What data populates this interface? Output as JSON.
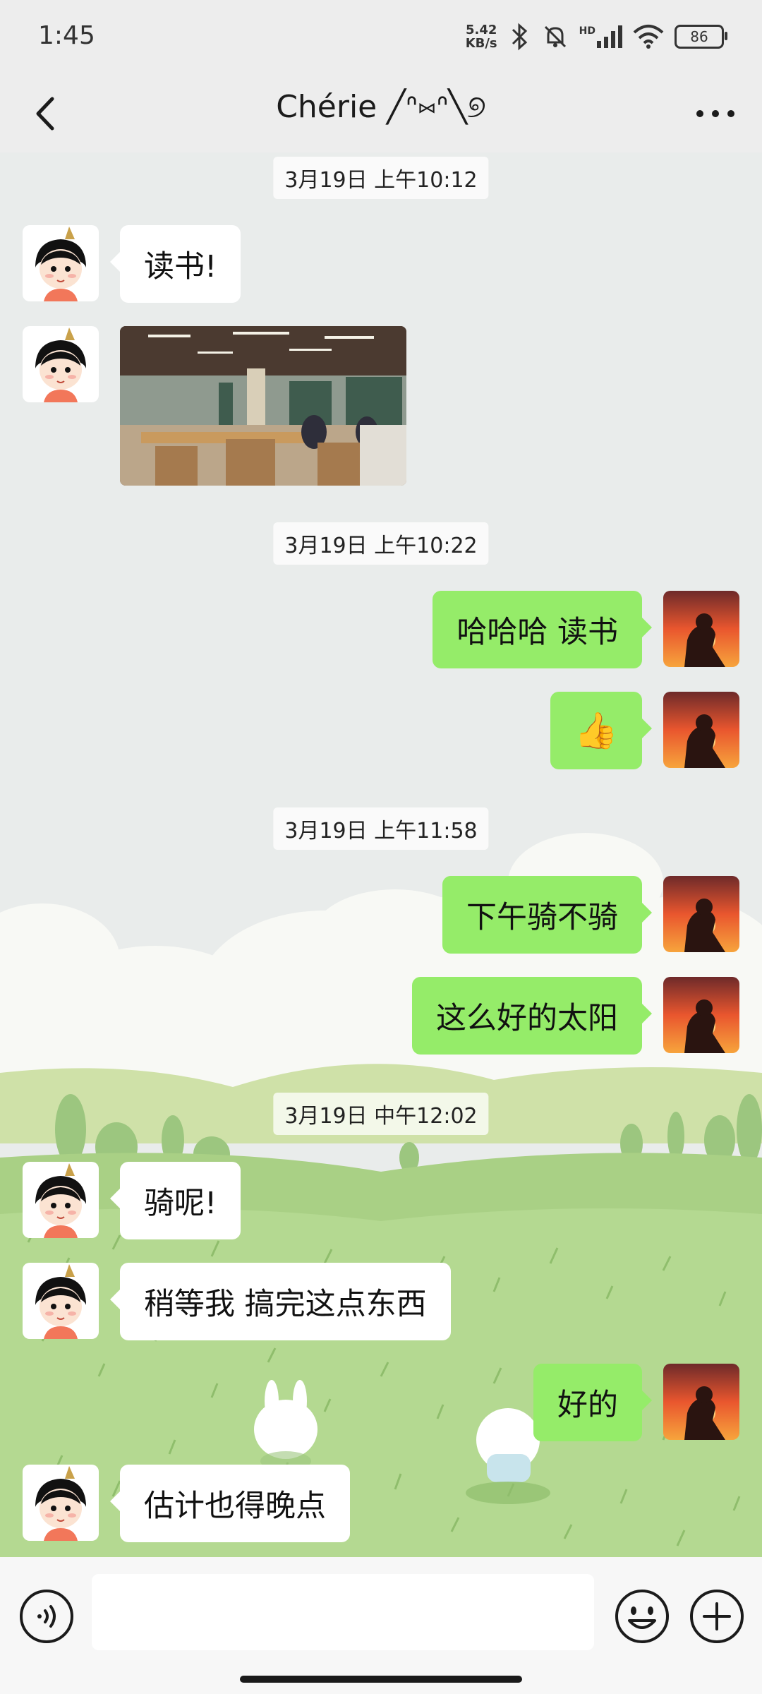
{
  "status_bar": {
    "time": "1:45",
    "net_speed_value": "5.42",
    "net_speed_unit": "KB/s",
    "hd_label": "HD",
    "battery": "86",
    "icons": [
      "bluetooth-icon",
      "mute-bell-icon",
      "signal-icon",
      "wifi-icon",
      "battery-icon"
    ]
  },
  "nav": {
    "title": "Chérie ╱ᐢ⑅ᐢ╲୭",
    "back_icon": "chevron-left-icon",
    "more_icon": "more-dots-icon"
  },
  "chat": {
    "timestamps": [
      "3月19日 上午10:12",
      "3月19日 上午10:22",
      "3月19日 上午11:58",
      "3月19日 中午12:02"
    ],
    "messages": [
      {
        "from": "contact",
        "text": "读书!"
      },
      {
        "from": "contact",
        "type": "image",
        "alt": "library-photo"
      },
      {
        "from": "me",
        "text": "哈哈哈 读书"
      },
      {
        "from": "me",
        "text": "👍"
      },
      {
        "from": "me",
        "text": "下午骑不骑"
      },
      {
        "from": "me",
        "text": "这么好的太阳"
      },
      {
        "from": "contact",
        "text": "骑呢!"
      },
      {
        "from": "contact",
        "text": "稍等我 搞完这点东西"
      },
      {
        "from": "me",
        "text": "好的"
      },
      {
        "from": "contact",
        "text": "估计也得晚点"
      }
    ]
  },
  "input_bar": {
    "voice_icon": "voice-icon",
    "emoji_icon": "emoji-icon",
    "plus_icon": "plus-circle-icon",
    "text_value": ""
  },
  "colors": {
    "outgoing_bubble": "#95EC69",
    "incoming_bubble": "#FFFFFF",
    "background": "#EDEDED"
  }
}
